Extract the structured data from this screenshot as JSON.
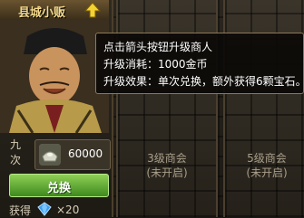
{
  "merchant": {
    "title": "县城小贩",
    "upgrade_icon": "up-arrow-icon",
    "side_label_top": "九",
    "side_label_bottom": "次",
    "cost_icon": "silver-ingot-icon",
    "cost_value": "60000",
    "exchange_label": "兑换",
    "reward_label": "获得",
    "reward_icon": "blue-gem-icon",
    "reward_count": "×20"
  },
  "slots": [
    {
      "name": "3级商会",
      "status": "(未开启)"
    },
    {
      "name": "5级商会",
      "status": "(未开启)"
    }
  ],
  "tooltip": {
    "line1": "点击箭头按钮升级商人",
    "line2": "升级消耗：1000金币",
    "line3": "升级效果：单次兑换，额外获得6颗宝石。"
  },
  "colors": {
    "title_gold": "#f4d98a",
    "button_green": "#5aa82f",
    "gem_blue": "#3a9df0",
    "locked_text": "#a99f8a"
  }
}
